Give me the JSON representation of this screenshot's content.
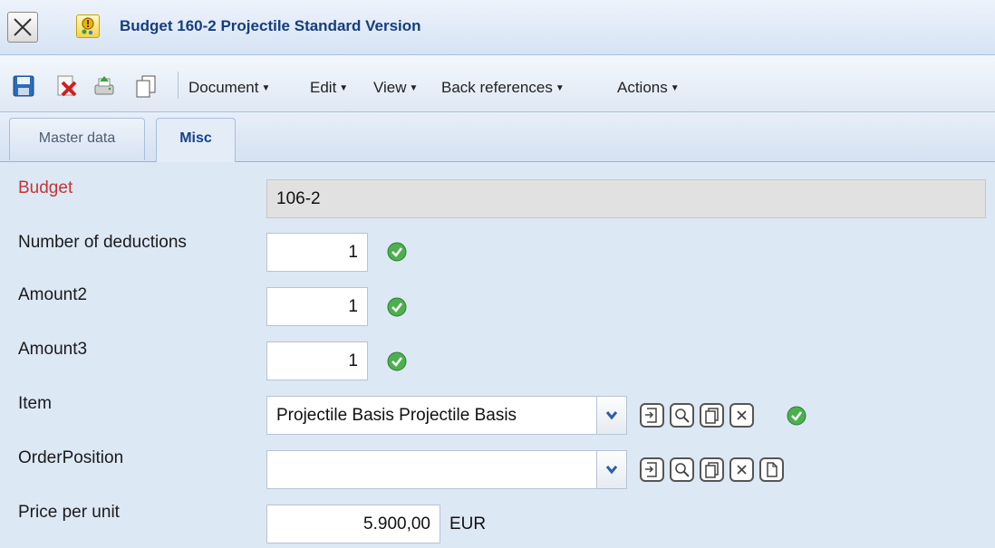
{
  "window": {
    "title": "Budget 160-2 Projectile Standard Version",
    "close_icon": "close-icon",
    "app_icon": "budget-app-icon"
  },
  "toolbar": {
    "icons": [
      "save-icon",
      "delete-icon",
      "print-icon",
      "copy-icon"
    ],
    "menus": [
      "Document",
      "Edit",
      "View",
      "Back references",
      "Actions"
    ]
  },
  "tabs": [
    {
      "label": "Master data",
      "active": false
    },
    {
      "label": "Misc",
      "active": true
    }
  ],
  "form": {
    "budget": {
      "label": "Budget",
      "value": "106-2",
      "required": true
    },
    "deductions": {
      "label": "Number of deductions",
      "value": "1"
    },
    "amount2": {
      "label": "Amount2",
      "value": "1"
    },
    "amount3": {
      "label": "Amount3",
      "value": "1"
    },
    "item": {
      "label": "Item",
      "value": "Projectile Basis Projectile Basis",
      "actions": [
        "open-icon",
        "search-icon",
        "copy-icon",
        "clear-icon"
      ]
    },
    "order_position": {
      "label": "OrderPosition",
      "value": "",
      "actions": [
        "open-icon",
        "search-icon",
        "copy-icon",
        "clear-icon",
        "new-document-icon"
      ]
    },
    "price": {
      "label": "Price per unit",
      "value": "5.900,00",
      "unit": "EUR"
    }
  },
  "colors": {
    "accent": "#153e7e",
    "required_label": "#c23535",
    "valid": "#4caf50",
    "background": "#dde8f5"
  }
}
